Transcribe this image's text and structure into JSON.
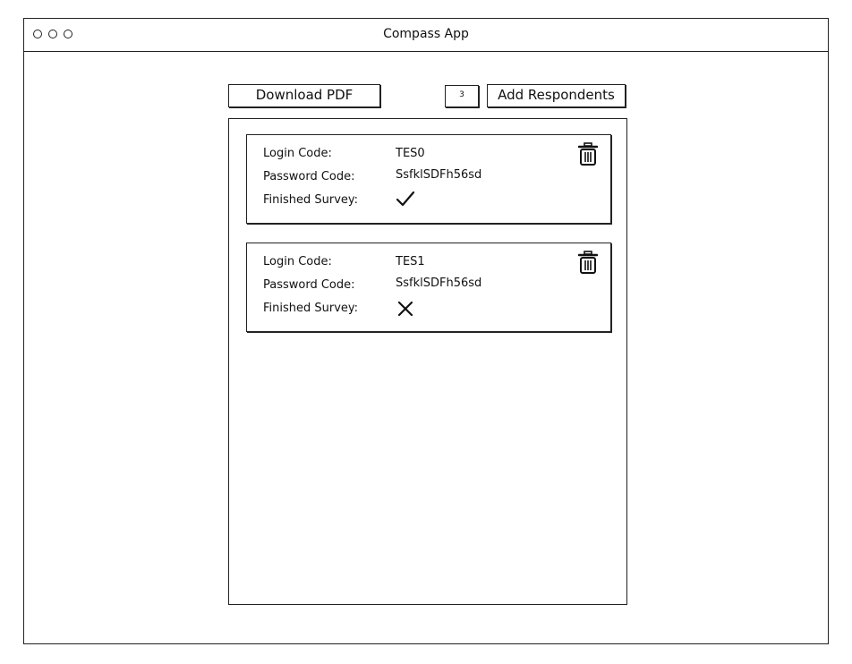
{
  "window": {
    "title": "Compass App"
  },
  "toolbar": {
    "download_label": "Download PDF",
    "count_value": "3",
    "add_label": "Add Respondents"
  },
  "respondents": [
    {
      "login_label": "Login Code:",
      "login_value": "TES0",
      "password_label": "Password Code:",
      "password_value": "SsfklSDFh56sd",
      "finished_label": "Finished Survey:",
      "finished": true
    },
    {
      "login_label": "Login Code:",
      "login_value": "TES1",
      "password_label": "Password Code:",
      "password_value": "SsfklSDFh56sd",
      "finished_label": "Finished Survey:",
      "finished": false
    }
  ],
  "icons": {
    "delete": "trash-icon",
    "finished_yes": "checkmark-icon",
    "finished_no": "cross-icon"
  }
}
